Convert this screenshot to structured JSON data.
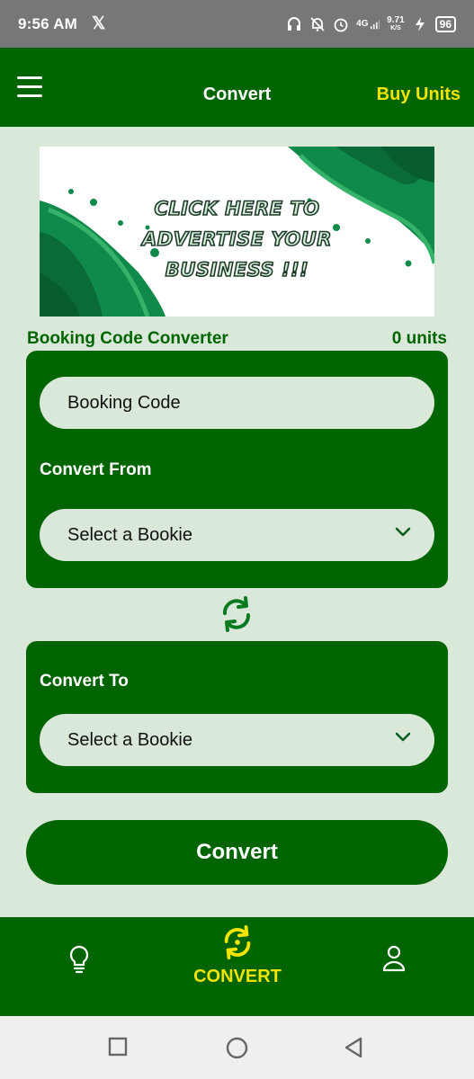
{
  "status_bar": {
    "time": "9:56 AM",
    "network": "4G",
    "speed_value": "9.71",
    "speed_unit": "K/S",
    "battery": "96"
  },
  "app_bar": {
    "title": "Convert",
    "buy_units": "Buy Units"
  },
  "banner": {
    "lines": [
      "Click here to",
      "advertise your",
      "business !!!"
    ],
    "paint_color": "#0f8a4a"
  },
  "converter": {
    "section_title": "Booking Code Converter",
    "units": "0 units",
    "booking_code_placeholder": "Booking Code",
    "convert_from_label": "Convert From",
    "from_select_value": "Select a Bookie",
    "convert_to_label": "Convert To",
    "to_select_value": "Select a Bookie",
    "convert_button": "Convert"
  },
  "bottom_nav": {
    "items": [
      {
        "icon": "lightbulb-icon",
        "label": ""
      },
      {
        "icon": "convert-icon",
        "label": "CONVERT"
      },
      {
        "icon": "person-icon",
        "label": ""
      }
    ]
  },
  "colors": {
    "primary_green": "#006400",
    "background": "#d9e8d8",
    "accent_yellow": "#f2e300"
  }
}
